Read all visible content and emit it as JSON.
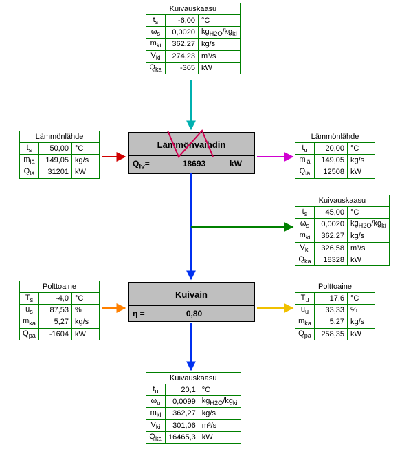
{
  "gas_in": {
    "title": "Kuivauskaasu",
    "r": [
      {
        "s": "t<sub>s</sub>",
        "v": "-6,00",
        "u": "°C"
      },
      {
        "s": "ω<sub>s</sub>",
        "v": "0,0020",
        "u": "kg<sub>H2O</sub>/kg<sub>ki</sub>"
      },
      {
        "s": "m<sub>ki</sub>",
        "v": "362,27",
        "u": "kg/s"
      },
      {
        "s": "V<sub>ki</sub>",
        "v": "274,23",
        "u": "m³/s"
      },
      {
        "s": "Q<sub>ka</sub>",
        "v": "-365",
        "u": "kW"
      }
    ]
  },
  "heat_src_in": {
    "title": "Lämmönlähde",
    "r": [
      {
        "s": "t<sub>s</sub>",
        "v": "50,00",
        "u": "°C"
      },
      {
        "s": "m<sub>lä</sub>",
        "v": "149,05",
        "u": "kg/s"
      },
      {
        "s": "Q<sub>lä</sub>",
        "v": "31201",
        "u": "kW"
      }
    ]
  },
  "heat_src_out": {
    "title": "Lämmönlähde",
    "r": [
      {
        "s": "t<sub>u</sub>",
        "v": "20,00",
        "u": "°C"
      },
      {
        "s": "m<sub>lä</sub>",
        "v": "149,05",
        "u": "kg/s"
      },
      {
        "s": "Q<sub>lä</sub>",
        "v": "12508",
        "u": "kW"
      }
    ]
  },
  "gas_mid": {
    "title": "Kuivauskaasu",
    "r": [
      {
        "s": "t<sub>s</sub>",
        "v": "45,00",
        "u": "°C"
      },
      {
        "s": "ω<sub>s</sub>",
        "v": "0,0020",
        "u": "kg<sub>H2O</sub>/kg<sub>ki</sub>"
      },
      {
        "s": "m<sub>ki</sub>",
        "v": "362,27",
        "u": "kg/s"
      },
      {
        "s": "V<sub>ki</sub>",
        "v": "326,58",
        "u": "m³/s"
      },
      {
        "s": "Q<sub>ka</sub>",
        "v": "18328",
        "u": "kW"
      }
    ]
  },
  "fuel_in": {
    "title": "Polttoaine",
    "r": [
      {
        "s": "T<sub>s</sub>",
        "v": "-4,0",
        "u": "°C"
      },
      {
        "s": "u<sub>s</sub>",
        "v": "87,53",
        "u": "%"
      },
      {
        "s": "m<sub>ka</sub>",
        "v": "5,27",
        "u": "kg/s"
      },
      {
        "s": "Q<sub>pa</sub>",
        "v": "-1604",
        "u": "kW"
      }
    ]
  },
  "fuel_out": {
    "title": "Polttoaine",
    "r": [
      {
        "s": "T<sub>u</sub>",
        "v": "17,6",
        "u": "°C"
      },
      {
        "s": "u<sub>u</sub>",
        "v": "33,33",
        "u": "%"
      },
      {
        "s": "m<sub>ka</sub>",
        "v": "5,27",
        "u": "kg/s"
      },
      {
        "s": "Q<sub>pa</sub>",
        "v": "258,35",
        "u": "kW"
      }
    ]
  },
  "gas_out": {
    "title": "Kuivauskaasu",
    "r": [
      {
        "s": "t<sub>u</sub>",
        "v": "20,1",
        "u": "°C"
      },
      {
        "s": "ω<sub>u</sub>",
        "v": "0,0099",
        "u": "kg<sub>H2O</sub>/kg<sub>ki</sub>"
      },
      {
        "s": "m<sub>ki</sub>",
        "v": "362,27",
        "u": "kg/s"
      },
      {
        "s": "V<sub>ki</sub>",
        "v": "301,06",
        "u": "m³/s"
      },
      {
        "s": "Q<sub>ka</sub>",
        "v": "16465,3",
        "u": "kW"
      }
    ]
  },
  "hx": {
    "title": "Lämmönvaihdin",
    "label": "Q<sub>lv</sub>=",
    "value": "18693",
    "unit": "kW"
  },
  "dryer": {
    "title": "Kuivain",
    "label": "η =",
    "value": "0,80",
    "unit": ""
  }
}
